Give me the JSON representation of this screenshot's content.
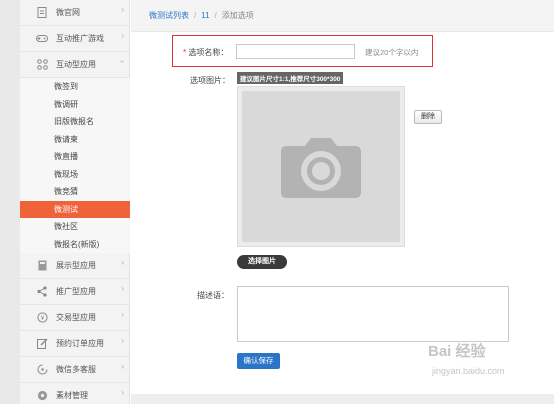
{
  "sidebar": {
    "top_items": [
      {
        "label": "微官网",
        "icon": "document-icon"
      },
      {
        "label": "互动推广游戏",
        "icon": "gamepad-icon"
      },
      {
        "label": "互动型应用",
        "icon": "apps-icon"
      }
    ],
    "sub_items": [
      "微签到",
      "微调研",
      "旧版微报名",
      "微请柬",
      "微直播",
      "微现场",
      "微竞猜",
      "微测试",
      "微社区",
      "微报名(新版)"
    ],
    "active_sub": "微测试",
    "bottom_items": [
      {
        "label": "展示型应用",
        "icon": "page-icon"
      },
      {
        "label": "推广型应用",
        "icon": "share-icon"
      },
      {
        "label": "交易型应用",
        "icon": "coin-icon"
      },
      {
        "label": "预约订单应用",
        "icon": "edit-icon"
      },
      {
        "label": "微信多客服",
        "icon": "chat-icon"
      },
      {
        "label": "素材管理",
        "icon": "media-icon"
      }
    ]
  },
  "breadcrumb": {
    "link1": "微测试列表",
    "sep1": "/",
    "link2": "11",
    "sep2": "/",
    "current": "添加选项"
  },
  "form": {
    "name_required_mark": "*",
    "name_label": "选项名称：",
    "name_value": "",
    "name_hint": "建议20个字以内",
    "image_label": "选项图片：",
    "image_tip": "建议图片尺寸1:1,推荐尺寸300*300",
    "delete_button": "删除",
    "choose_button": "选择图片",
    "desc_label": "描述语：",
    "desc_value": "",
    "save_button": "确认保存"
  },
  "watermark": {
    "main": "Bai 经验",
    "sub": "jingyan.baidu.com"
  },
  "colors": {
    "accent": "#f0633a",
    "link": "#2b75c9",
    "highlight": "#e03030"
  }
}
